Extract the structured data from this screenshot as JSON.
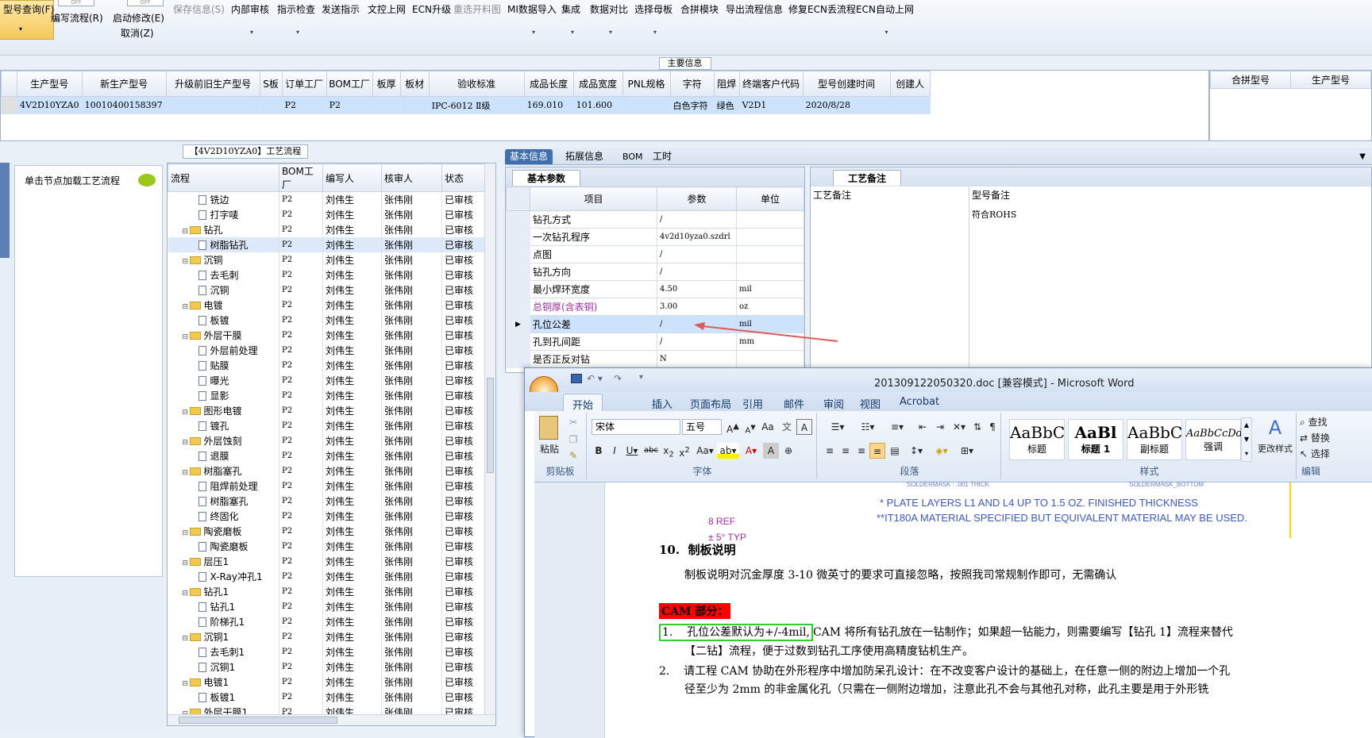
{
  "menu": {
    "items": [
      {
        "label": "型号查询(F)",
        "dim": false
      },
      {
        "label": "编写流程(R)",
        "dim": false
      },
      {
        "label": "启动修改(E)",
        "sub": "取消(Z)",
        "dim": false
      },
      {
        "label": "保存信息(S)",
        "dim": true
      },
      {
        "label": "内部审核",
        "dim": false
      },
      {
        "label": "指示检查",
        "dim": false
      },
      {
        "label": "发送指示",
        "dim": false
      },
      {
        "label": "文控上网",
        "dim": false
      },
      {
        "label": "ECN升级",
        "dim": false
      },
      {
        "label": "重选开料图",
        "dim": true
      },
      {
        "label": "MI数据导入",
        "dim": false
      },
      {
        "label": "集成",
        "dim": false
      },
      {
        "label": "数据对比",
        "dim": false
      },
      {
        "label": "选择母板",
        "dim": false
      },
      {
        "label": "合拼模块",
        "dim": false
      },
      {
        "label": "导出流程信息",
        "dim": false
      },
      {
        "label": "修复ECN丢流程",
        "dim": false
      },
      {
        "label": "ECN自动上网",
        "dim": false
      }
    ],
    "toggle_off": "OFF"
  },
  "main_header": "主要信息",
  "main_grid": {
    "columns": [
      "生产型号",
      "新生产型号",
      "升级前旧生产型号",
      "S板",
      "订单工厂",
      "BOM工厂",
      "板厚",
      "板材",
      "验收标准",
      "成品长度",
      "成品宽度",
      "PNL规格",
      "字符",
      "阻焊",
      "终端客户代码",
      "型号创建时间",
      "创建人"
    ],
    "row": [
      "4V2D10YZA0",
      "10010400158397",
      "",
      "",
      "P2",
      "P2",
      "",
      "",
      "IPC-6012 Ⅱ级",
      "169.010",
      "101.600",
      "",
      "白色字符",
      "绿色",
      "V2D1",
      "2020/8/28",
      ""
    ]
  },
  "side_grid": {
    "columns": [
      "合拼型号",
      "生产型号"
    ]
  },
  "left_panel": {
    "hint": "单击节点加载工艺流程"
  },
  "process": {
    "title": "【4V2D10YZA0】工艺流程",
    "columns": [
      "流程",
      "BOM工厂",
      "编写人",
      "核审人",
      "状态"
    ],
    "rows": [
      {
        "name": "铣边",
        "leaf": true,
        "f": "P2",
        "w": "刘伟生",
        "c": "张伟刚",
        "s": "已审核"
      },
      {
        "name": "打字唛",
        "leaf": true,
        "f": "P2",
        "w": "刘伟生",
        "c": "张伟刚",
        "s": "已审核"
      },
      {
        "name": "钻孔",
        "leaf": false,
        "f": "P2",
        "w": "刘伟生",
        "c": "张伟刚",
        "s": "已审核"
      },
      {
        "name": "树脂钻孔",
        "leaf": true,
        "f": "P2",
        "w": "刘伟生",
        "c": "张伟刚",
        "s": "已审核",
        "sel": true
      },
      {
        "name": "沉铜",
        "leaf": false,
        "f": "P2",
        "w": "刘伟生",
        "c": "张伟刚",
        "s": "已审核"
      },
      {
        "name": "去毛刺",
        "leaf": true,
        "f": "P2",
        "w": "刘伟生",
        "c": "张伟刚",
        "s": "已审核"
      },
      {
        "name": "沉铜",
        "leaf": true,
        "f": "P2",
        "w": "刘伟生",
        "c": "张伟刚",
        "s": "已审核"
      },
      {
        "name": "电镀",
        "leaf": false,
        "f": "P2",
        "w": "刘伟生",
        "c": "张伟刚",
        "s": "已审核"
      },
      {
        "name": "板镀",
        "leaf": true,
        "f": "P2",
        "w": "刘伟生",
        "c": "张伟刚",
        "s": "已审核"
      },
      {
        "name": "外层干膜",
        "leaf": false,
        "f": "P2",
        "w": "刘伟生",
        "c": "张伟刚",
        "s": "已审核"
      },
      {
        "name": "外层前处理",
        "leaf": true,
        "f": "P2",
        "w": "刘伟生",
        "c": "张伟刚",
        "s": "已审核"
      },
      {
        "name": "贴膜",
        "leaf": true,
        "f": "P2",
        "w": "刘伟生",
        "c": "张伟刚",
        "s": "已审核"
      },
      {
        "name": "曝光",
        "leaf": true,
        "f": "P2",
        "w": "刘伟生",
        "c": "张伟刚",
        "s": "已审核"
      },
      {
        "name": "显影",
        "leaf": true,
        "f": "P2",
        "w": "刘伟生",
        "c": "张伟刚",
        "s": "已审核"
      },
      {
        "name": "图形电镀",
        "leaf": false,
        "f": "P2",
        "w": "刘伟生",
        "c": "张伟刚",
        "s": "已审核"
      },
      {
        "name": "镀孔",
        "leaf": true,
        "f": "P2",
        "w": "刘伟生",
        "c": "张伟刚",
        "s": "已审核"
      },
      {
        "name": "外层蚀刻",
        "leaf": false,
        "f": "P2",
        "w": "刘伟生",
        "c": "张伟刚",
        "s": "已审核"
      },
      {
        "name": "退膜",
        "leaf": true,
        "f": "P2",
        "w": "刘伟生",
        "c": "张伟刚",
        "s": "已审核"
      },
      {
        "name": "树脂塞孔",
        "leaf": false,
        "f": "P2",
        "w": "刘伟生",
        "c": "张伟刚",
        "s": "已审核"
      },
      {
        "name": "阻焊前处理",
        "leaf": true,
        "f": "P2",
        "w": "刘伟生",
        "c": "张伟刚",
        "s": "已审核"
      },
      {
        "name": "树脂塞孔",
        "leaf": true,
        "f": "P2",
        "w": "刘伟生",
        "c": "张伟刚",
        "s": "已审核"
      },
      {
        "name": "终固化",
        "leaf": true,
        "f": "P2",
        "w": "刘伟生",
        "c": "张伟刚",
        "s": "已审核"
      },
      {
        "name": "陶瓷磨板",
        "leaf": false,
        "f": "P2",
        "w": "刘伟生",
        "c": "张伟刚",
        "s": "已审核"
      },
      {
        "name": "陶瓷磨板",
        "leaf": true,
        "f": "P2",
        "w": "刘伟生",
        "c": "张伟刚",
        "s": "已审核"
      },
      {
        "name": "层压1",
        "leaf": false,
        "f": "P2",
        "w": "刘伟生",
        "c": "张伟刚",
        "s": "已审核"
      },
      {
        "name": "X-Ray冲孔1",
        "leaf": true,
        "f": "P2",
        "w": "刘伟生",
        "c": "张伟刚",
        "s": "已审核"
      },
      {
        "name": "钻孔1",
        "leaf": false,
        "f": "P2",
        "w": "刘伟生",
        "c": "张伟刚",
        "s": "已审核"
      },
      {
        "name": "钻孔1",
        "leaf": true,
        "f": "P2",
        "w": "刘伟生",
        "c": "张伟刚",
        "s": "已审核"
      },
      {
        "name": "阶梯孔1",
        "leaf": true,
        "f": "P2",
        "w": "刘伟生",
        "c": "张伟刚",
        "s": "已审核"
      },
      {
        "name": "沉铜1",
        "leaf": false,
        "f": "P2",
        "w": "刘伟生",
        "c": "张伟刚",
        "s": "已审核"
      },
      {
        "name": "去毛刺1",
        "leaf": true,
        "f": "P2",
        "w": "刘伟生",
        "c": "张伟刚",
        "s": "已审核"
      },
      {
        "name": "沉铜1",
        "leaf": true,
        "f": "P2",
        "w": "刘伟生",
        "c": "张伟刚",
        "s": "已审核"
      },
      {
        "name": "电镀1",
        "leaf": false,
        "f": "P2",
        "w": "刘伟生",
        "c": "张伟刚",
        "s": "已审核"
      },
      {
        "name": "板镀1",
        "leaf": true,
        "f": "P2",
        "w": "刘伟生",
        "c": "张伟刚",
        "s": "已审核"
      },
      {
        "name": "外层干膜1",
        "leaf": false,
        "f": "P2",
        "w": "刘伟生",
        "c": "张伟刚",
        "s": "已审核"
      }
    ]
  },
  "right_tabs": [
    "基本信息",
    "拓展信息",
    "BOM",
    "工时"
  ],
  "basic": {
    "subtab": "基本参数",
    "columns": [
      "项目",
      "参数",
      "单位"
    ],
    "rows": [
      {
        "item": "钻孔方式",
        "param": "/",
        "unit": ""
      },
      {
        "item": "一次钻孔程序",
        "param": "4v2d10yza0.szdrl",
        "unit": ""
      },
      {
        "item": "点图",
        "param": "/",
        "unit": ""
      },
      {
        "item": "钻孔方向",
        "param": "/",
        "unit": ""
      },
      {
        "item": "最小焊环宽度",
        "param": "4.50",
        "unit": "mil"
      },
      {
        "item": "总铜厚(含表铜)",
        "param": "3.00",
        "unit": "oz",
        "highlight": true
      },
      {
        "item": "孔位公差",
        "param": "/",
        "unit": "mil",
        "current": true
      },
      {
        "item": "孔到孔间距",
        "param": "/",
        "unit": "mm"
      },
      {
        "item": "是否正反对钻",
        "param": "N",
        "unit": ""
      }
    ]
  },
  "notes": {
    "subtab": "工艺备注",
    "columns": [
      "工艺备注",
      "型号备注"
    ],
    "model_note": "符合ROHS"
  },
  "word": {
    "title": "201309122050320.doc [兼容模式] - Microsoft Word",
    "tabs": [
      "开始",
      "插入",
      "页面布局",
      "引用",
      "邮件",
      "审阅",
      "视图",
      "Acrobat"
    ],
    "paste": "粘贴",
    "font_name": "宋体",
    "font_size": "五号",
    "groups": {
      "clipboard": "剪贴板",
      "font": "字体",
      "paragraph": "段落",
      "styles": "样式",
      "edit": "编辑"
    },
    "styles": [
      {
        "preview": "AaBbC",
        "name": "标题"
      },
      {
        "preview": "AaBl",
        "name": "标题 1"
      },
      {
        "preview": "AaBbC",
        "name": "副标题"
      },
      {
        "preview": "AaBbCcDd",
        "name": "强调"
      }
    ],
    "change_styles": "更改样式",
    "edit_items": [
      "查找",
      "替换",
      "选择"
    ],
    "colors": {
      "highlight_red": "#ff0000",
      "box_green": "#33cc33",
      "link_blue": "#3a58c7",
      "arrow_red": "#e05a5a"
    }
  },
  "doc": {
    "solder_left": "SOLDERMASK : .001 THICK",
    "solder_right": "SOLDERMASK_BOTTOM",
    "plate_note": "* PLATE LAYERS L1 AND L4 UP TO 1.5 OZ. FINISHED THICKNESS",
    "material_note": "**IT180A MATERIAL SPECIFIED BUT EQUIVALENT MATERIAL MAY BE USED.",
    "ref": "8 REF",
    "typ": "± 5° TYP",
    "heading_num": "10.",
    "heading": "制板说明",
    "para": "制板说明对沉金厚度 3-10 微英寸的要求可直接忽略，按照我司常规制作即可，无需确认",
    "cam": "CAM 部分：",
    "item1_num": "1.",
    "item1_boxed": "孔位公差默认为+/-4mil,",
    "item1_rest": "CAM 将所有钻孔放在一钻制作；如果超一钻能力，则需要编写【钻孔 1】流程来替代",
    "item1_line2": "【二钻】流程，便于过数到钻孔工序使用高精度钻机生产。",
    "item2_num": "2.",
    "item2": "请工程 CAM 协助在外形程序中增加防呆孔设计：在不改变客户设计的基础上，在任意一侧的附边上增加一个孔",
    "item2_line2": "径至少为 2mm 的非金属化孔（只需在一侧附边增加，注意此孔不会与其他孔对称，此孔主要是用于外形铣"
  }
}
